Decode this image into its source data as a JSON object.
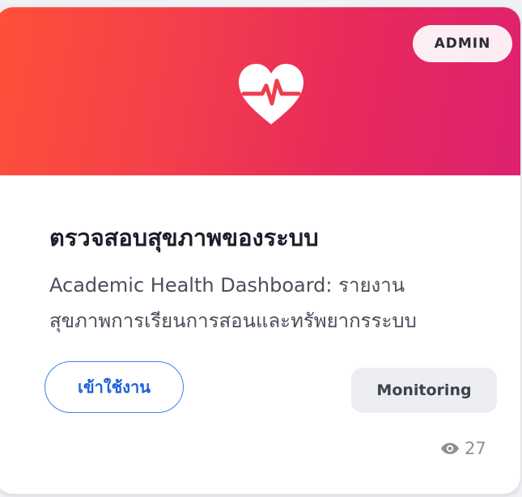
{
  "card": {
    "badge": "ADMIN",
    "icon": "heart-pulse-icon",
    "title": "ตรวจสอบสุขภาพของระบบ",
    "description_line1": "Academic Health Dashboard: รายงาน",
    "description_line2": "สุขภาพการเรียนการสอนและทรัพยากรระบบ",
    "enter_button": "เข้าใช้งาน",
    "category_tag": "Monitoring",
    "views_icon": "eye-icon",
    "views_count": "27",
    "colors": {
      "banner_start": "#ff5038",
      "banner_end": "#de2170",
      "button_border": "#3b82f6",
      "button_text": "#1d5ed8"
    }
  }
}
